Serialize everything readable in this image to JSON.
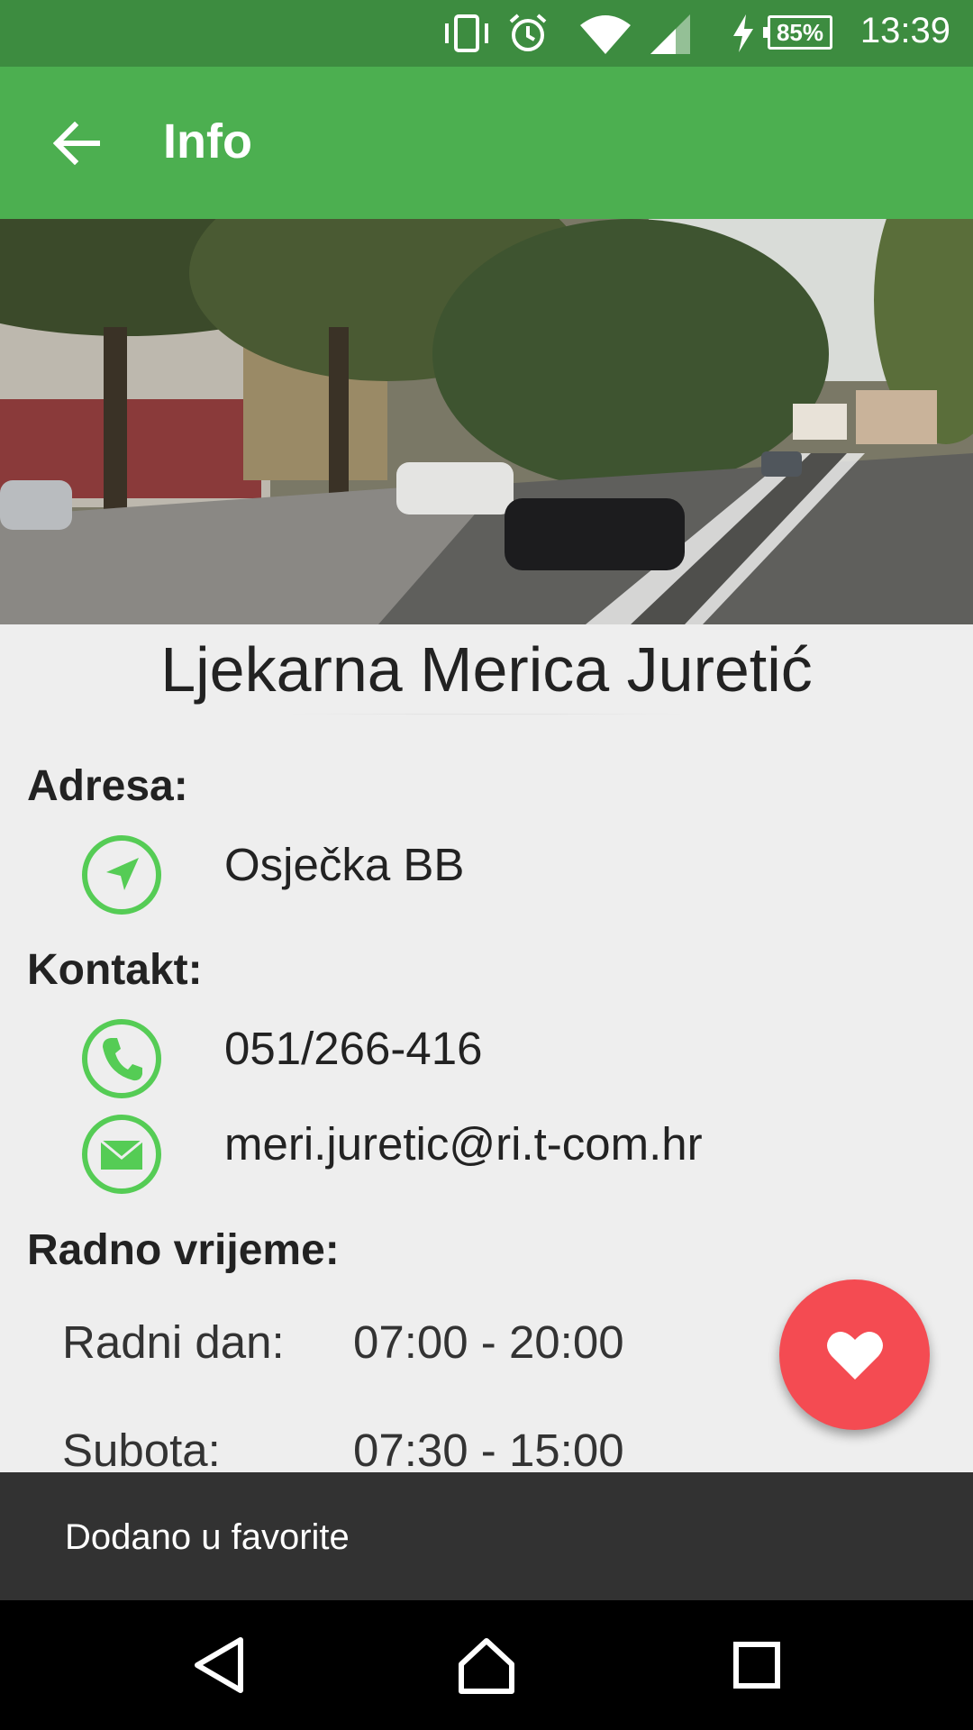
{
  "status_bar": {
    "time": "13:39",
    "battery": "85%",
    "icons": [
      "vibrate-icon",
      "alarm-icon",
      "wifi-icon",
      "signal-icon",
      "charging-icon",
      "battery-icon"
    ]
  },
  "app_bar": {
    "title": "Info",
    "back_icon": "arrow-back-icon"
  },
  "place": {
    "name": "Ljekarna Merica Juretić"
  },
  "address": {
    "label": "Adresa:",
    "value": "Osječka BB",
    "icon": "navigation-icon"
  },
  "contact": {
    "label": "Kontakt:",
    "phone": "051/266-416",
    "email": "meri.juretic@ri.t-com.hr",
    "phone_icon": "phone-icon",
    "email_icon": "mail-icon"
  },
  "hours": {
    "label": "Radno vrijeme:",
    "rows": [
      {
        "day": "Radni dan:",
        "time": "07:00 - 20:00"
      },
      {
        "day": "Subota:",
        "time": "07:30 - 15:00"
      }
    ]
  },
  "fab": {
    "icon": "heart-icon"
  },
  "snackbar": {
    "text": "Dodano u favorite"
  },
  "nav_bar": {
    "icons": [
      "back-triangle-icon",
      "home-icon",
      "recents-icon"
    ]
  },
  "colors": {
    "status_bar": "#3d8c40",
    "app_bar": "#4caf50",
    "accent_green": "#55cc55",
    "fab": "#f44b52",
    "snackbar": "#323232"
  }
}
